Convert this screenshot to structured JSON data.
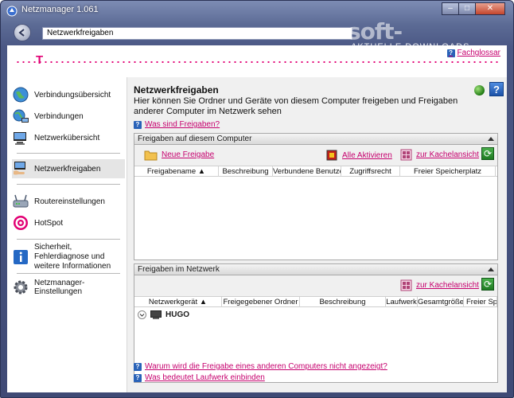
{
  "window": {
    "title": "Netzmanager 1.061",
    "controls": [
      "minimize",
      "maximize",
      "close"
    ]
  },
  "navbar": {
    "address": "Netzwerkfreigaben",
    "watermark": "soft-ware.net",
    "watermark_sub": "AKTUELLE DOWNLOADS"
  },
  "brand": {
    "logo": "T",
    "accent": "#e20074",
    "help_link": "Fachglossar"
  },
  "sidebar": {
    "items": [
      {
        "label": "Verbindungsübersicht",
        "icon": "globe-icon"
      },
      {
        "label": "Verbindungen",
        "icon": "network-globe-icon"
      },
      {
        "label": "Netzwerkübersicht",
        "icon": "computer-icon"
      },
      {
        "label": "Netzwerkfreigaben",
        "icon": "shared-computer-icon",
        "active": true
      },
      {
        "label": "Routereinstellungen",
        "icon": "router-icon"
      },
      {
        "label": "HotSpot",
        "icon": "hotspot-target-icon"
      },
      {
        "label": "Sicherheit, Fehlerdiagnose und weitere Informationen",
        "icon": "info-icon"
      },
      {
        "label": "Netzmanager-Einstellungen",
        "icon": "gear-icon"
      }
    ]
  },
  "main": {
    "title": "Netzwerkfreigaben",
    "description": "Hier können Sie Ordner und Geräte von diesem Computer freigeben und Freigaben anderer Computer im Netzwerk sehen",
    "what_link": "Was sind Freigaben?",
    "local_group": {
      "title": "Freigaben auf diesem Computer",
      "new_share": "Neue Freigabe",
      "activate_all": "Alle Aktivieren",
      "tile_view": "zur Kachelansicht",
      "columns": [
        "Freigabename",
        "Beschreibung",
        "Verbundene Benutzer",
        "Zugriffsrecht",
        "Freier Speicherplatz"
      ]
    },
    "network_group": {
      "title": "Freigaben im Netzwerk",
      "tile_view": "zur Kachelansicht",
      "columns": [
        "Netzwerkgerät",
        "Freigegebener Ordner",
        "Beschreibung",
        "Laufwerk",
        "Gesamtgröße",
        "Freier Spei"
      ],
      "rows": [
        {
          "device": "HUGO"
        }
      ]
    },
    "footer_links": [
      "Warum wird die Freigabe eines anderen Computers nicht angezeigt?",
      "Was bedeutet Laufwerk einbinden"
    ]
  }
}
